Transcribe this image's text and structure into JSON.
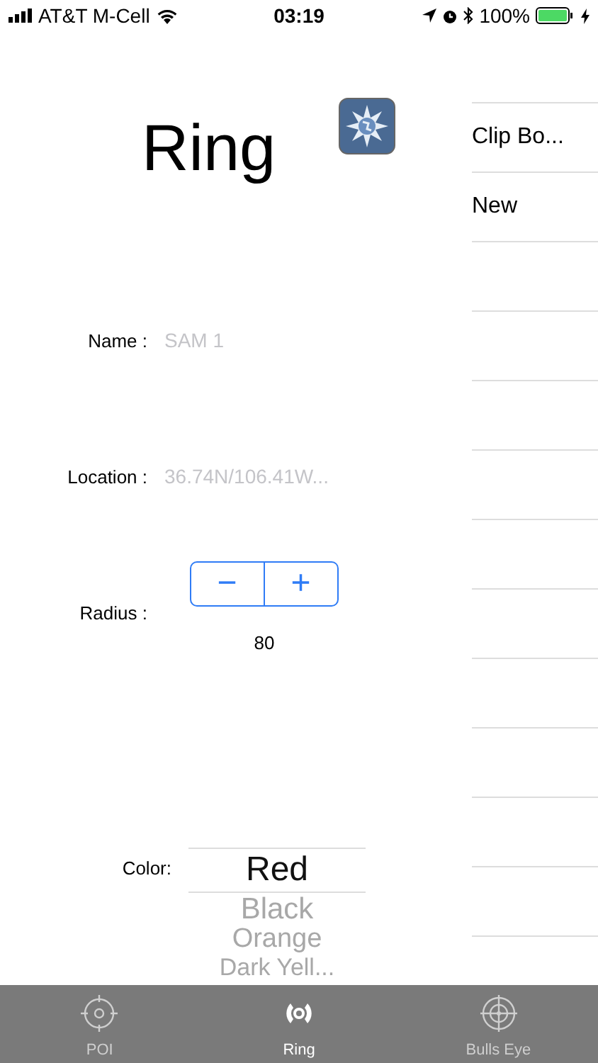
{
  "status_bar": {
    "carrier": "AT&T M-Cell",
    "time": "03:19",
    "battery": "100%"
  },
  "title": "Ring",
  "form": {
    "name": {
      "label": "Name :",
      "placeholder": "SAM 1"
    },
    "location": {
      "label": "Location :",
      "placeholder": "36.74N/106.41W..."
    },
    "radius": {
      "label": "Radius :",
      "minus": "−",
      "plus": "+",
      "value": "80"
    },
    "color": {
      "label": "Color:",
      "options": [
        {
          "label": "Red",
          "selected": true
        },
        {
          "label": "Black",
          "selected": false
        },
        {
          "label": "Orange",
          "selected": false
        },
        {
          "label": "Dark Yell...",
          "selected": false
        }
      ]
    }
  },
  "side_list": [
    {
      "label": "Clip Bo..."
    },
    {
      "label": "New"
    }
  ],
  "tabs": [
    {
      "label": "POI",
      "kind": "poi",
      "selected": false
    },
    {
      "label": "Ring",
      "kind": "ring",
      "selected": true
    },
    {
      "label": "Bulls Eye",
      "kind": "bullseye",
      "selected": false
    }
  ]
}
